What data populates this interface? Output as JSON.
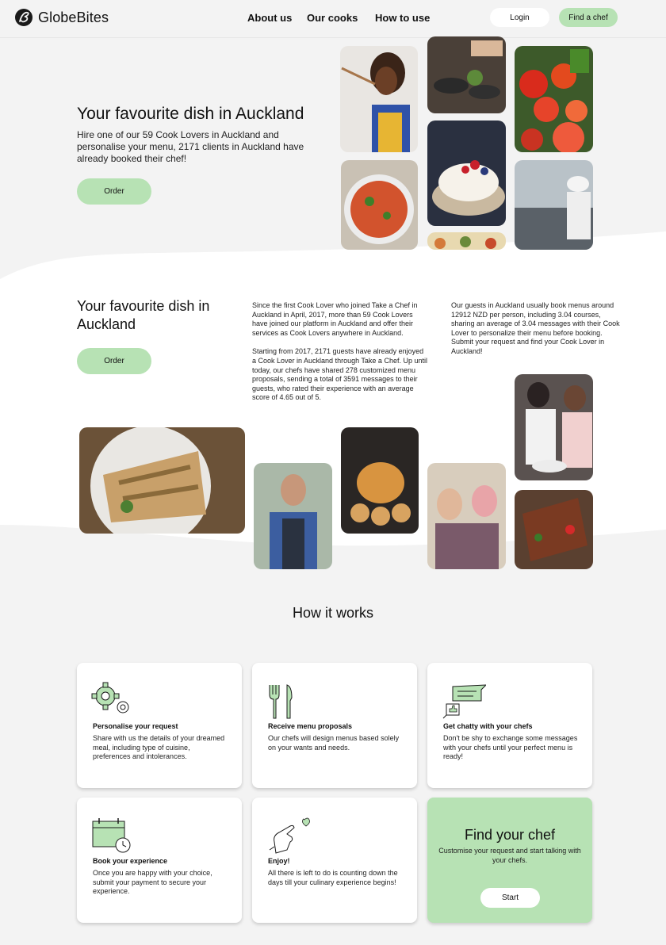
{
  "brand": {
    "name": "GlobeBites"
  },
  "nav": {
    "links": [
      "About us",
      "Our cooks",
      "How to use"
    ],
    "login": "Login",
    "find_chef": "Find a chef"
  },
  "hero": {
    "title": "Your favourite dish in Auckland",
    "subtitle": "Hire one of our 59 Cook Lovers in Auckland and personalise your menu, 2171 clients in Auckland have already booked their chef!",
    "order": "Order"
  },
  "about": {
    "title": "Your favourite dish in Auckland",
    "order": "Order",
    "col1_p1": "Since the first Cook Lover who joined Take a Chef in Auckland in April, 2017, more than 59 Cook Lovers have joined our platform in Auckland and offer their services as Cook Lovers anywhere in Auckland.",
    "col1_p2": "Starting from 2017, 2171 guests have already enjoyed a Cook Lover in Auckland through Take a Chef. Up until today, our chefs have shared 278 customized menu proposals, sending a total of 3591 messages to their guests, who rated their experience with an average score of 4.65 out of 5.",
    "col2_p1": "Our guests in Auckland usually book menus around 12912 NZD per person, including 3.04 courses, sharing an average of 3.04 messages with their Cook Lover to personalize their menu before booking. Submit your request and find your Cook Lover in Auckland!"
  },
  "how": {
    "title": "How it works",
    "steps": [
      {
        "icon": "gears-icon",
        "title": "Personalise your request",
        "text": "Share with us the details of your dreamed meal, including type of cuisine, preferences and intolerances."
      },
      {
        "icon": "cutlery-icon",
        "title": "Receive menu proposals",
        "text": "Our chefs will design menus based solely on your wants and needs."
      },
      {
        "icon": "chat-icon",
        "title": "Get chatty with your chefs",
        "text": "Don't be shy to exchange some messages with your chefs until your perfect menu is ready!"
      },
      {
        "icon": "calendar-icon",
        "title": "Book your experience",
        "text": "Once you are happy with your choice, submit your payment to secure your experience."
      },
      {
        "icon": "heart-hand-icon",
        "title": "Enjoy!",
        "text": "All there is left to do is counting down the days till your culinary experience begins!"
      }
    ],
    "find": {
      "title": "Find your chef",
      "subtitle": "Customise your request and start talking with your chefs.",
      "start": "Start"
    }
  },
  "colors": {
    "accent": "#b7e2b4",
    "background": "#f3f3f3",
    "card": "#ffffff"
  }
}
